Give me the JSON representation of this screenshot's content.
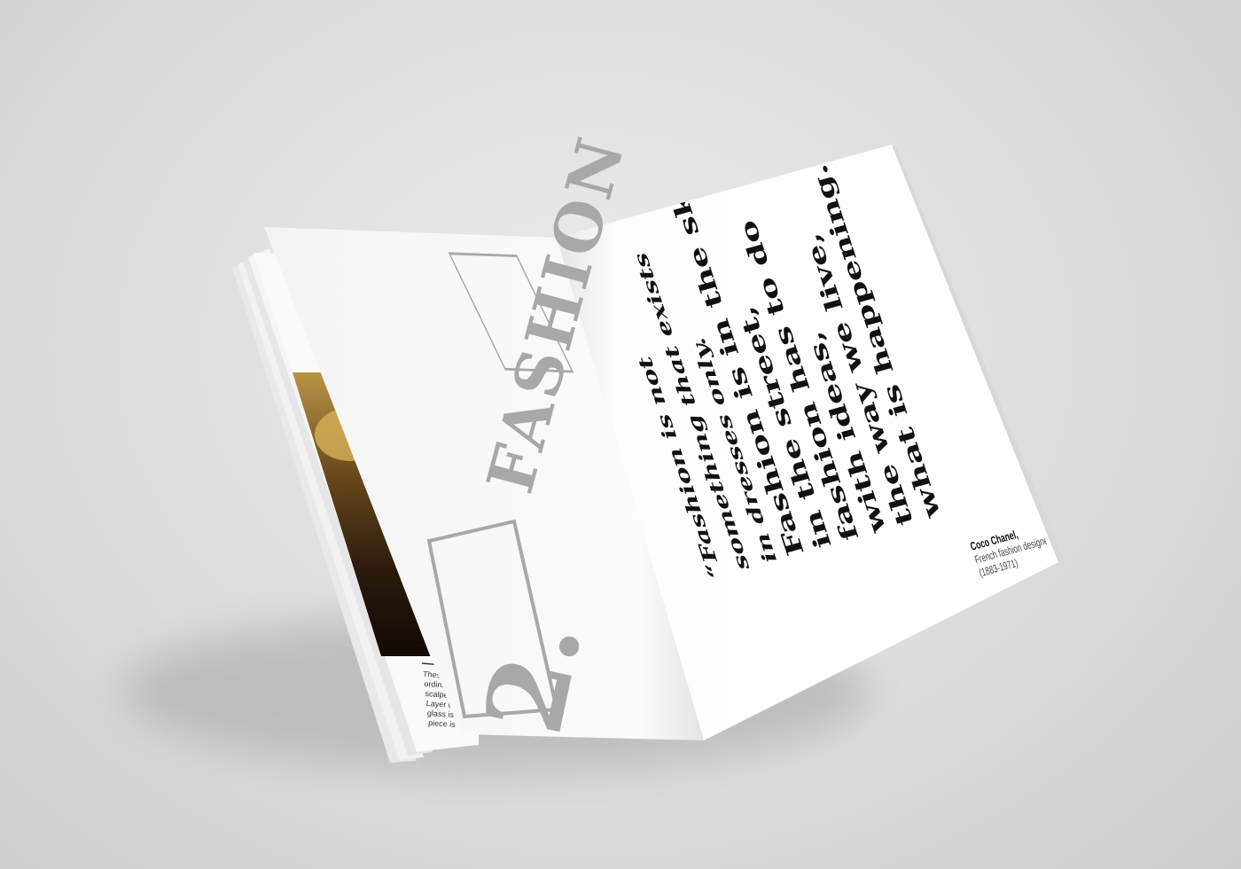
{
  "colors": {
    "background": "#dcdcdc",
    "paper": "#ffffff",
    "grey_text": "#a8a8a8",
    "black_text": "#111111"
  },
  "left_page": {
    "number": "2.",
    "title": "FASHION",
    "caption_fragments": [
      "These",
      "ordinary",
      "scalpel is",
      "Layer up",
      "glass is",
      "piece is"
    ]
  },
  "right_page": {
    "quote_lines": [
      "“Fashion is not",
      "something that exists",
      "in dresses only.",
      "Fashion is in the sky,",
      "in the street,",
      "fashion has to do",
      "with ideas,",
      "the way we live,",
      "what is happening.”"
    ],
    "credit": {
      "name": "Coco Chanel,",
      "role": "French fashion designer",
      "years": "(1883-1971)"
    }
  }
}
